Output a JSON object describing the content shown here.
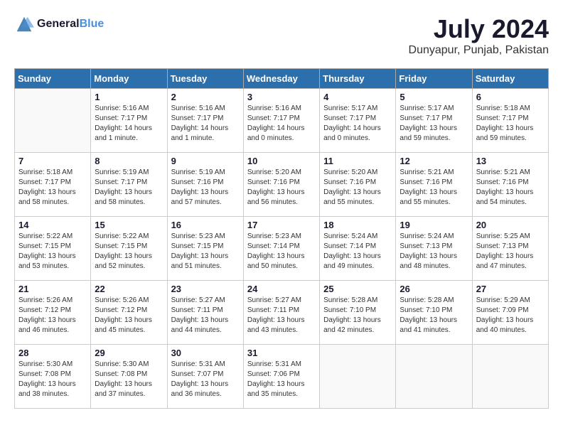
{
  "logo": {
    "line1": "General",
    "line2": "Blue"
  },
  "title": "July 2024",
  "subtitle": "Dunyapur, Punjab, Pakistan",
  "weekdays": [
    "Sunday",
    "Monday",
    "Tuesday",
    "Wednesday",
    "Thursday",
    "Friday",
    "Saturday"
  ],
  "weeks": [
    [
      {
        "day": "",
        "sunrise": "",
        "sunset": "",
        "daylight": ""
      },
      {
        "day": "1",
        "sunrise": "Sunrise: 5:16 AM",
        "sunset": "Sunset: 7:17 PM",
        "daylight": "Daylight: 14 hours and 1 minute."
      },
      {
        "day": "2",
        "sunrise": "Sunrise: 5:16 AM",
        "sunset": "Sunset: 7:17 PM",
        "daylight": "Daylight: 14 hours and 1 minute."
      },
      {
        "day": "3",
        "sunrise": "Sunrise: 5:16 AM",
        "sunset": "Sunset: 7:17 PM",
        "daylight": "Daylight: 14 hours and 0 minutes."
      },
      {
        "day": "4",
        "sunrise": "Sunrise: 5:17 AM",
        "sunset": "Sunset: 7:17 PM",
        "daylight": "Daylight: 14 hours and 0 minutes."
      },
      {
        "day": "5",
        "sunrise": "Sunrise: 5:17 AM",
        "sunset": "Sunset: 7:17 PM",
        "daylight": "Daylight: 13 hours and 59 minutes."
      },
      {
        "day": "6",
        "sunrise": "Sunrise: 5:18 AM",
        "sunset": "Sunset: 7:17 PM",
        "daylight": "Daylight: 13 hours and 59 minutes."
      }
    ],
    [
      {
        "day": "7",
        "sunrise": "Sunrise: 5:18 AM",
        "sunset": "Sunset: 7:17 PM",
        "daylight": "Daylight: 13 hours and 58 minutes."
      },
      {
        "day": "8",
        "sunrise": "Sunrise: 5:19 AM",
        "sunset": "Sunset: 7:17 PM",
        "daylight": "Daylight: 13 hours and 58 minutes."
      },
      {
        "day": "9",
        "sunrise": "Sunrise: 5:19 AM",
        "sunset": "Sunset: 7:16 PM",
        "daylight": "Daylight: 13 hours and 57 minutes."
      },
      {
        "day": "10",
        "sunrise": "Sunrise: 5:20 AM",
        "sunset": "Sunset: 7:16 PM",
        "daylight": "Daylight: 13 hours and 56 minutes."
      },
      {
        "day": "11",
        "sunrise": "Sunrise: 5:20 AM",
        "sunset": "Sunset: 7:16 PM",
        "daylight": "Daylight: 13 hours and 55 minutes."
      },
      {
        "day": "12",
        "sunrise": "Sunrise: 5:21 AM",
        "sunset": "Sunset: 7:16 PM",
        "daylight": "Daylight: 13 hours and 55 minutes."
      },
      {
        "day": "13",
        "sunrise": "Sunrise: 5:21 AM",
        "sunset": "Sunset: 7:16 PM",
        "daylight": "Daylight: 13 hours and 54 minutes."
      }
    ],
    [
      {
        "day": "14",
        "sunrise": "Sunrise: 5:22 AM",
        "sunset": "Sunset: 7:15 PM",
        "daylight": "Daylight: 13 hours and 53 minutes."
      },
      {
        "day": "15",
        "sunrise": "Sunrise: 5:22 AM",
        "sunset": "Sunset: 7:15 PM",
        "daylight": "Daylight: 13 hours and 52 minutes."
      },
      {
        "day": "16",
        "sunrise": "Sunrise: 5:23 AM",
        "sunset": "Sunset: 7:15 PM",
        "daylight": "Daylight: 13 hours and 51 minutes."
      },
      {
        "day": "17",
        "sunrise": "Sunrise: 5:23 AM",
        "sunset": "Sunset: 7:14 PM",
        "daylight": "Daylight: 13 hours and 50 minutes."
      },
      {
        "day": "18",
        "sunrise": "Sunrise: 5:24 AM",
        "sunset": "Sunset: 7:14 PM",
        "daylight": "Daylight: 13 hours and 49 minutes."
      },
      {
        "day": "19",
        "sunrise": "Sunrise: 5:24 AM",
        "sunset": "Sunset: 7:13 PM",
        "daylight": "Daylight: 13 hours and 48 minutes."
      },
      {
        "day": "20",
        "sunrise": "Sunrise: 5:25 AM",
        "sunset": "Sunset: 7:13 PM",
        "daylight": "Daylight: 13 hours and 47 minutes."
      }
    ],
    [
      {
        "day": "21",
        "sunrise": "Sunrise: 5:26 AM",
        "sunset": "Sunset: 7:12 PM",
        "daylight": "Daylight: 13 hours and 46 minutes."
      },
      {
        "day": "22",
        "sunrise": "Sunrise: 5:26 AM",
        "sunset": "Sunset: 7:12 PM",
        "daylight": "Daylight: 13 hours and 45 minutes."
      },
      {
        "day": "23",
        "sunrise": "Sunrise: 5:27 AM",
        "sunset": "Sunset: 7:11 PM",
        "daylight": "Daylight: 13 hours and 44 minutes."
      },
      {
        "day": "24",
        "sunrise": "Sunrise: 5:27 AM",
        "sunset": "Sunset: 7:11 PM",
        "daylight": "Daylight: 13 hours and 43 minutes."
      },
      {
        "day": "25",
        "sunrise": "Sunrise: 5:28 AM",
        "sunset": "Sunset: 7:10 PM",
        "daylight": "Daylight: 13 hours and 42 minutes."
      },
      {
        "day": "26",
        "sunrise": "Sunrise: 5:28 AM",
        "sunset": "Sunset: 7:10 PM",
        "daylight": "Daylight: 13 hours and 41 minutes."
      },
      {
        "day": "27",
        "sunrise": "Sunrise: 5:29 AM",
        "sunset": "Sunset: 7:09 PM",
        "daylight": "Daylight: 13 hours and 40 minutes."
      }
    ],
    [
      {
        "day": "28",
        "sunrise": "Sunrise: 5:30 AM",
        "sunset": "Sunset: 7:08 PM",
        "daylight": "Daylight: 13 hours and 38 minutes."
      },
      {
        "day": "29",
        "sunrise": "Sunrise: 5:30 AM",
        "sunset": "Sunset: 7:08 PM",
        "daylight": "Daylight: 13 hours and 37 minutes."
      },
      {
        "day": "30",
        "sunrise": "Sunrise: 5:31 AM",
        "sunset": "Sunset: 7:07 PM",
        "daylight": "Daylight: 13 hours and 36 minutes."
      },
      {
        "day": "31",
        "sunrise": "Sunrise: 5:31 AM",
        "sunset": "Sunset: 7:06 PM",
        "daylight": "Daylight: 13 hours and 35 minutes."
      },
      {
        "day": "",
        "sunrise": "",
        "sunset": "",
        "daylight": ""
      },
      {
        "day": "",
        "sunrise": "",
        "sunset": "",
        "daylight": ""
      },
      {
        "day": "",
        "sunrise": "",
        "sunset": "",
        "daylight": ""
      }
    ]
  ]
}
